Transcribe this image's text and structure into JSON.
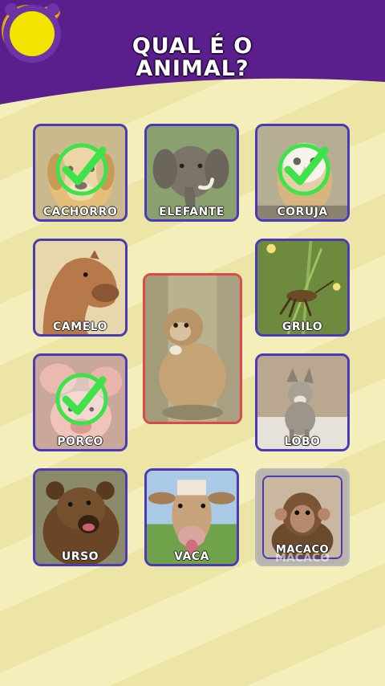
{
  "title": {
    "line1": "QUAL É O",
    "line2": "ANIMAL?"
  },
  "colors": {
    "header": "#5a1f8c",
    "tile_border": "#4b3ab8",
    "selected_border": "#d94b4b",
    "check": "#3ee34a",
    "timer": "#f2e400"
  },
  "tiles": [
    {
      "label": "CACHORRO",
      "icon": "dog-photo",
      "checked": true
    },
    {
      "label": "ELEFANTE",
      "icon": "elephant-photo",
      "checked": false
    },
    {
      "label": "CORUJA",
      "icon": "owl-photo",
      "checked": true
    },
    {
      "label": "CAMELO",
      "icon": "camel-photo",
      "checked": false
    },
    {
      "label": "GRILO",
      "icon": "cricket-photo",
      "checked": false
    },
    {
      "label": "PORCO",
      "icon": "pig-photo",
      "checked": true
    },
    {
      "label": "LOBO",
      "icon": "wolf-photo",
      "checked": false
    },
    {
      "label": "URSO",
      "icon": "bear-photo",
      "checked": false
    },
    {
      "label": "VACA",
      "icon": "cow-photo",
      "checked": false
    },
    {
      "label": "MACACO",
      "ghost": "MACACO",
      "icon": "monkey-photo",
      "checked": false
    }
  ],
  "center": {
    "icon": "monkey-photo"
  }
}
